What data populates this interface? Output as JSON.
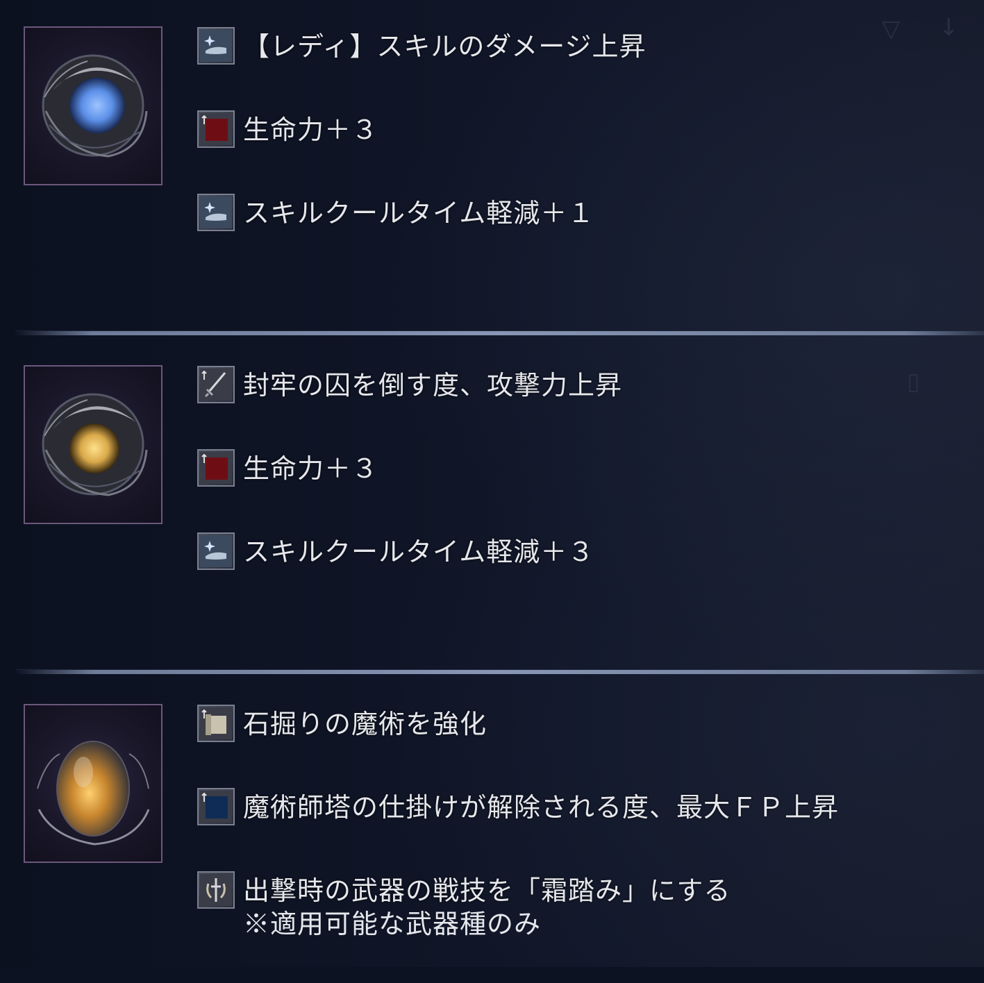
{
  "relics": [
    {
      "orb_colors": [
        "#5b8fe8",
        "#9ec4ff"
      ],
      "effects": [
        {
          "icon": "skill-hand-icon",
          "text": "【レディ】スキルのダメージ上昇"
        },
        {
          "icon": "vigor-red-icon",
          "text": "生命力＋３"
        },
        {
          "icon": "skill-hand-icon",
          "text": "スキルクールタイム軽減＋１"
        }
      ]
    },
    {
      "orb_colors": [
        "#d9a94a",
        "#ffe08a"
      ],
      "effects": [
        {
          "icon": "sword-icon",
          "text": "封牢の囚を倒す度、攻撃力上昇"
        },
        {
          "icon": "vigor-red-icon",
          "text": "生命力＋３"
        },
        {
          "icon": "skill-hand-icon",
          "text": "スキルクールタイム軽減＋３"
        }
      ]
    },
    {
      "orb_colors": [
        "#c8862e",
        "#ffd070"
      ],
      "effects": [
        {
          "icon": "scroll-icon",
          "text": "石掘りの魔術を強化"
        },
        {
          "icon": "mind-blue-icon",
          "text": "魔術師塔の仕掛けが解除される度、最大ＦＰ上昇"
        },
        {
          "icon": "weapon-skill-icon",
          "text": "出撃時の武器の戦技を「霜踏み」にする",
          "note": "※適用可能な武器種のみ"
        }
      ]
    }
  ]
}
